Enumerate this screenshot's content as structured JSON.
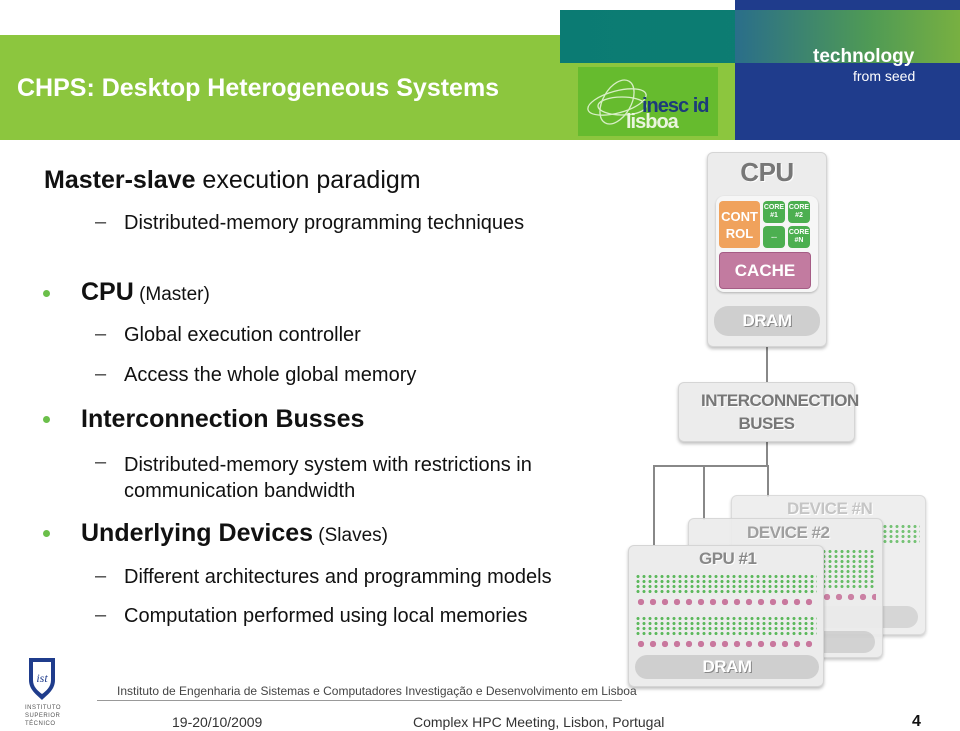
{
  "header": {
    "title": "CHPS: Desktop Heterogeneous Systems",
    "tagline_main": "technology",
    "tagline_sub": "from seed",
    "logo_text": [
      "inesc id",
      "lisboa"
    ]
  },
  "content": {
    "heading_bold": "Master-slave",
    "heading_rest": " execution paradigm",
    "heading_sub": "Distributed-memory programming techniques",
    "bullets": [
      {
        "bold": "CPU",
        "rest": " (Master)",
        "subs": [
          "Global execution controller",
          "Access the whole global memory"
        ]
      },
      {
        "bold": "Interconnection Busses",
        "rest": "",
        "subs": [
          "Distributed-memory system with  restrictions in communication bandwidth"
        ]
      },
      {
        "bold": "Underlying Devices",
        "rest": " (Slaves)",
        "subs": [
          "Different architectures and programming models",
          "Computation performed using local memories"
        ]
      }
    ]
  },
  "diagram": {
    "cpu": "CPU",
    "control": "CONT ROL",
    "cores": [
      "CORE #1",
      "CORE #2",
      "...",
      "CORE #N"
    ],
    "cache": "CACHE",
    "dram": "DRAM",
    "interconnect": "INTERCONNECTION BUSES",
    "devices": [
      "DEVICE #N",
      "DEVICE #2",
      "GPU #1"
    ],
    "device_dram": "DRAM",
    "colors": {
      "control": "#f0a25c",
      "core": "#4caf50",
      "cache": "#c27ba0"
    }
  },
  "footer": {
    "institute": "Instituto de Engenharia de Sistemas e Computadores Investigação e Desenvolvimento em Lisboa",
    "date": "19-20/10/2009",
    "event": "Complex HPC Meeting, Lisbon, Portugal",
    "page": "4",
    "ist_logo": [
      "INSTITUTO",
      "SUPERIOR",
      "TÉCNICO"
    ]
  }
}
